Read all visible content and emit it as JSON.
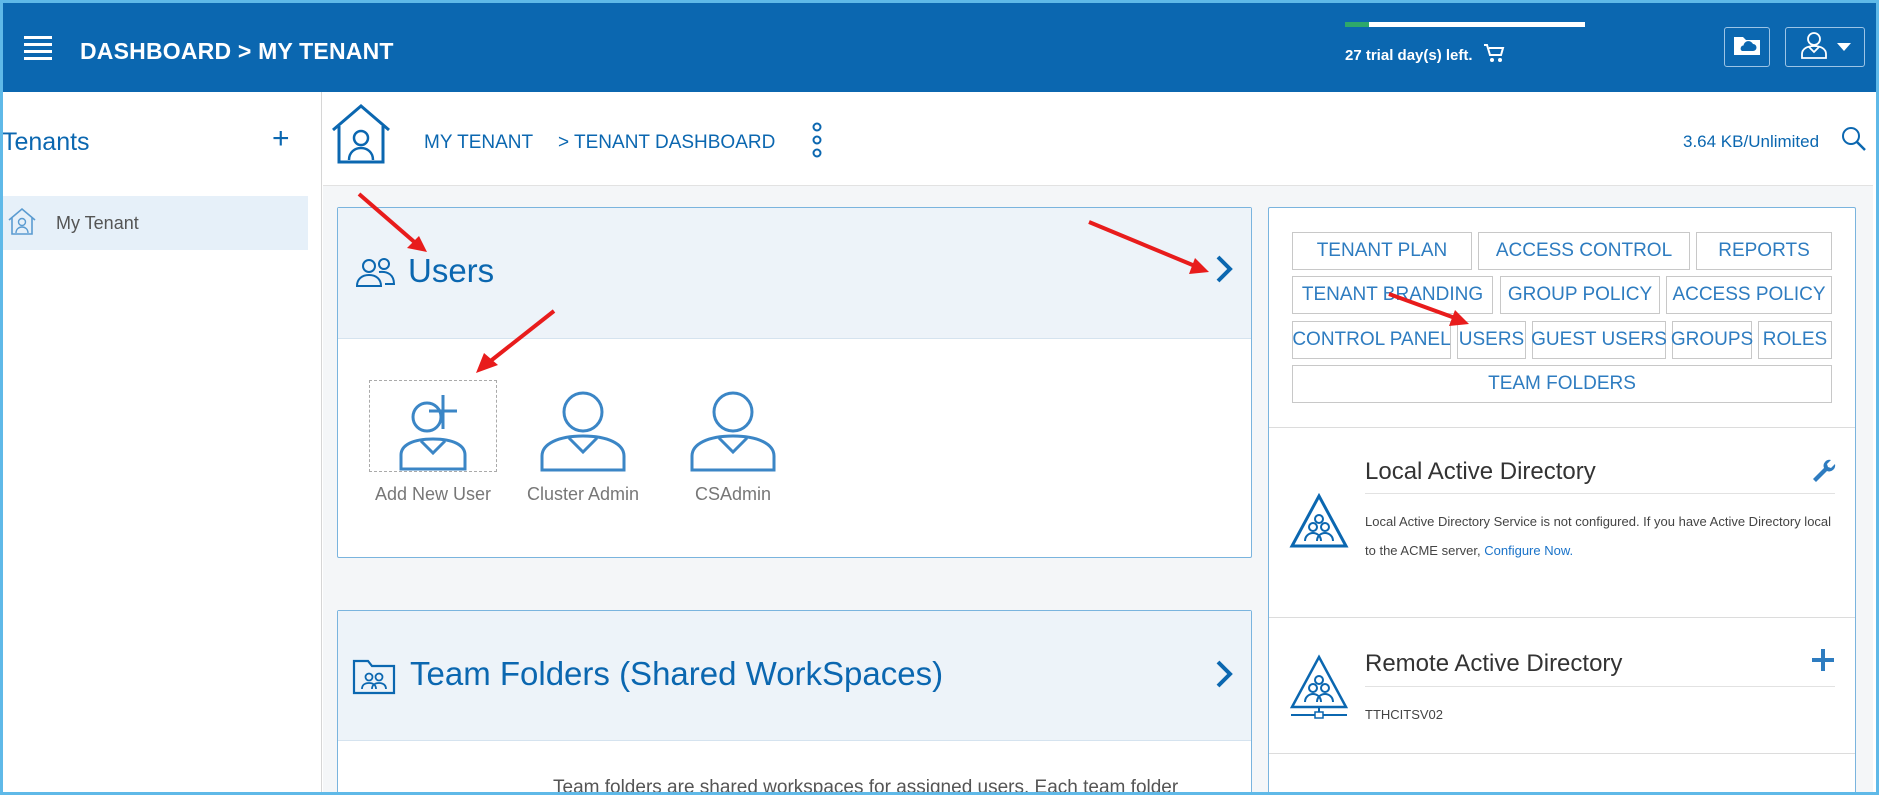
{
  "topbar": {
    "breadcrumb": "DASHBOARD > MY TENANT",
    "trial_text": "27 trial day(s) left.",
    "trial_progress": 0.1
  },
  "sidebar": {
    "title": "Tenants",
    "add_symbol": "+",
    "items": [
      {
        "label": "My Tenant"
      }
    ]
  },
  "main_header": {
    "tenant_link": "MY TENANT",
    "dashboard_link": "> TENANT DASHBOARD",
    "storage": "3.64 KB/Unlimited"
  },
  "users_panel": {
    "title": "Users",
    "users": [
      {
        "label": "Add New User"
      },
      {
        "label": "Cluster Admin"
      },
      {
        "label": "CSAdmin"
      }
    ]
  },
  "team_panel": {
    "title": "Team Folders (Shared WorkSpaces)",
    "description": "Team folders are shared workspaces for assigned users. Each team folder"
  },
  "right_panel": {
    "tags": [
      "TENANT PLAN",
      "ACCESS CONTROL",
      "REPORTS",
      "TENANT BRANDING",
      "GROUP POLICY",
      "ACCESS POLICY",
      "CONTROL PANEL",
      "USERS",
      "GUEST USERS",
      "GROUPS",
      "ROLES",
      "TEAM FOLDERS"
    ],
    "local_ad": {
      "title": "Local Active Directory",
      "text": "Local Active Directory Service is not configured. If you have Active Directory local to the ACME server,",
      "link": "Configure Now."
    },
    "remote_ad": {
      "title": "Remote Active Directory",
      "server": "TTHCITSV02"
    }
  },
  "colors": {
    "brand_blue": "#0b67b0",
    "annotation_red": "#e81c1c"
  }
}
